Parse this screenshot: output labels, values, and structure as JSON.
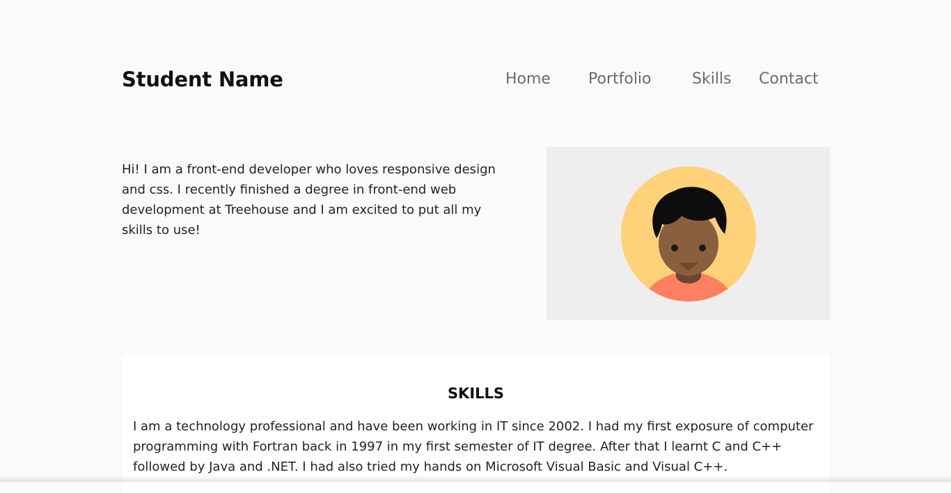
{
  "header": {
    "brand": "Student Name",
    "nav": {
      "home": "Home",
      "portfolio": "Portfolio",
      "skills": "Skills",
      "contact": "Contact"
    }
  },
  "intro": {
    "text": "Hi! I am a front-end developer who loves responsive design and css. I recently finished a degree in front-end web development at Treehouse and I am excited to put all my skills to use!"
  },
  "avatar": {
    "icon": "avatar-illustration-icon",
    "colors": {
      "frame_bg": "#eeeeee",
      "circle": "#ffd27a",
      "hair": "#0d0d0d",
      "skin": "#8a5f3e",
      "neck": "#6b4630",
      "shirt": "#ff8060"
    }
  },
  "skills": {
    "title": "SKILLS",
    "text": "I am a technology professional and have been working in IT since 2002. I had my first exposure of computer programming with Fortran back in 1997 in my first semester of IT degree. After that I learnt C and C++ followed by Java and .NET. I had also tried my hands on Microsoft Visual Basic and Visual C++."
  }
}
